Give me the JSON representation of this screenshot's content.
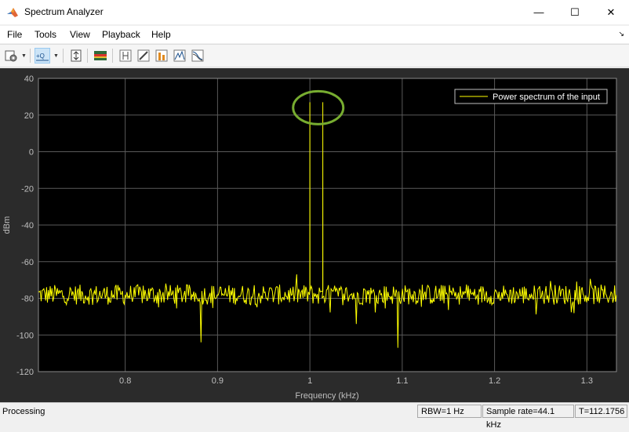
{
  "window": {
    "title": "Spectrum Analyzer",
    "minimize_glyph": "—",
    "maximize_glyph": "☐",
    "close_glyph": "✕"
  },
  "menu": {
    "items": [
      "File",
      "Tools",
      "View",
      "Playback",
      "Help"
    ]
  },
  "toolbar": {
    "buttons": [
      "settings-icon",
      "zoom-icon",
      "scale-axes-icon",
      "spectrogram-icon",
      "cursor-measurements-icon",
      "channel-measurements-icon",
      "distortion-icon",
      "peak-finder-icon",
      "ccdf-icon"
    ]
  },
  "plot": {
    "background": "#000000",
    "frame_color": "#2b2b2b",
    "grid_color": "#5a5a5a",
    "trace_color": "#ffff00",
    "highlight_color": "#77ac30"
  },
  "chart_data": {
    "type": "line",
    "title": "",
    "xlabel": "Frequency (kHz)",
    "ylabel": "dBm",
    "xlim": [
      0.706,
      1.332
    ],
    "ylim": [
      -120,
      40
    ],
    "xticks": [
      0.8,
      0.9,
      1,
      1.1,
      1.2,
      1.3
    ],
    "xtick_labels": [
      "0.8",
      "0.9",
      "1",
      "1.1",
      "1.2",
      "1.3"
    ],
    "yticks": [
      40,
      20,
      0,
      -20,
      -40,
      -60,
      -80,
      -100,
      -120
    ],
    "ytick_labels": [
      "40",
      "20",
      "0",
      "-20",
      "-40",
      "-60",
      "-80",
      "-100",
      "-120"
    ],
    "grid": true,
    "legend_position": "top-right",
    "series": [
      {
        "name": "Power spectrum of the input",
        "noise_floor": -78,
        "peaks": [
          {
            "x": 1.0,
            "y": 27
          },
          {
            "x": 1.014,
            "y": 27
          }
        ],
        "dips": [
          {
            "x": 0.882,
            "y": -104
          },
          {
            "x": 1.095,
            "y": -107
          },
          {
            "x": 1.05,
            "y": -94
          }
        ]
      }
    ],
    "annotations": [
      {
        "type": "ellipse",
        "cx": 1.009,
        "cy": 24
      }
    ]
  },
  "status": {
    "left": "Processing",
    "rbw": "RBW=1 Hz",
    "sample_rate": "Sample rate=44.1 kHz",
    "time": "T=112.1756"
  }
}
